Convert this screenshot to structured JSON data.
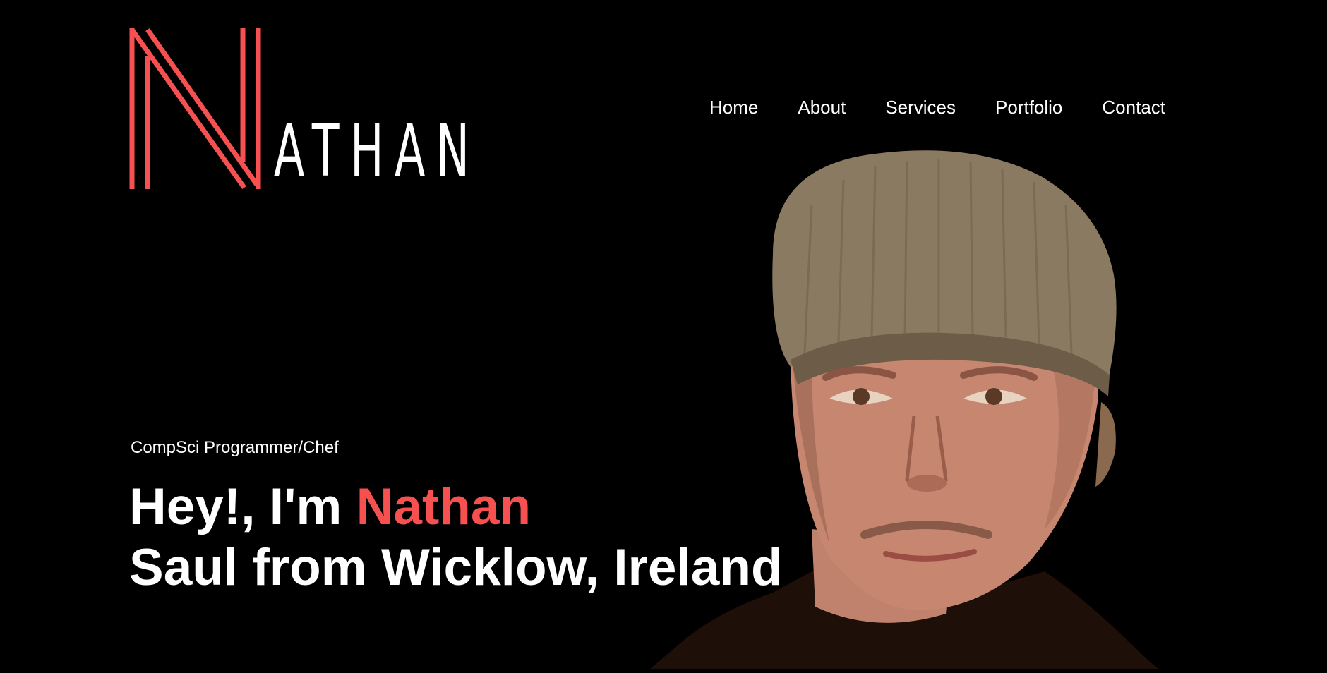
{
  "brand": {
    "initial": "N",
    "rest": "ATHAN",
    "accent_color": "#f75050"
  },
  "nav": {
    "items": [
      {
        "label": "Home"
      },
      {
        "label": "About"
      },
      {
        "label": "Services"
      },
      {
        "label": "Portfolio"
      },
      {
        "label": "Contact"
      }
    ]
  },
  "hero": {
    "tagline": "CompSci Programmer/Chef",
    "headline_prefix": "Hey!, I'm ",
    "headline_name": "Nathan",
    "headline_line2": "Saul from Wicklow, Ireland"
  },
  "portrait": {
    "icon": "person-portrait"
  }
}
